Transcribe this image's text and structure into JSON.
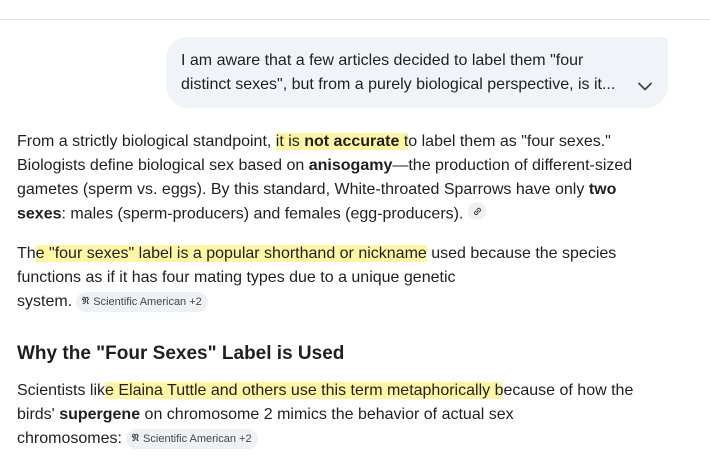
{
  "user_prompt": {
    "line1": "I am aware that a few articles decided to label them \"four",
    "line2": "distinct sexes\", but from a purely biological perspective, is it...",
    "expand_icon": "chevron-down-icon"
  },
  "response": {
    "p1": {
      "l1a": "From a strictly biological standpoint, ",
      "l1b": "it is ",
      "l1c": "not accurate",
      "l1d": " t",
      "l1e": "o label them as \"four sexes.\"",
      "l2a": "Biologists define biological sex based on ",
      "l2b": "anisogamy",
      "l2c": "—the production of different-sized",
      "l3a": "gametes (sperm vs. eggs). By this standard, White-throated Sparrows have only ",
      "l3b": "two",
      "l4a": "sexes",
      "l4b": ": males (sperm-producers) and females (egg-producers).",
      "link_icon": "link-icon"
    },
    "p2": {
      "l1a": "Th",
      "l1b": "e \"four sexes\" label is a popular shorthand or nickname",
      "l1c": " used because the species",
      "l2": "functions as if it has four mating types due to a unique genetic",
      "l3": "system.",
      "source_label": "Scientific American +2",
      "source_icon": "scientific-american-icon"
    },
    "heading": "Why the \"Four Sexes\" Label is Used",
    "p3": {
      "l1a": "Scientists lik",
      "l1b": "e Elaina Tuttle and others use this term metaphorically b",
      "l1c": "ecause of how the",
      "l2a": "birds' ",
      "l2b": "supergene",
      "l2c": " on chromosome 2 mimics the behavior of actual sex",
      "l3": "chromosomes:",
      "source_label": "Scientific American +2",
      "source_icon": "scientific-american-icon"
    }
  },
  "colors": {
    "highlight": "#fdf6a5",
    "bubble": "#f0f4f9",
    "chip": "#eef1f4"
  }
}
